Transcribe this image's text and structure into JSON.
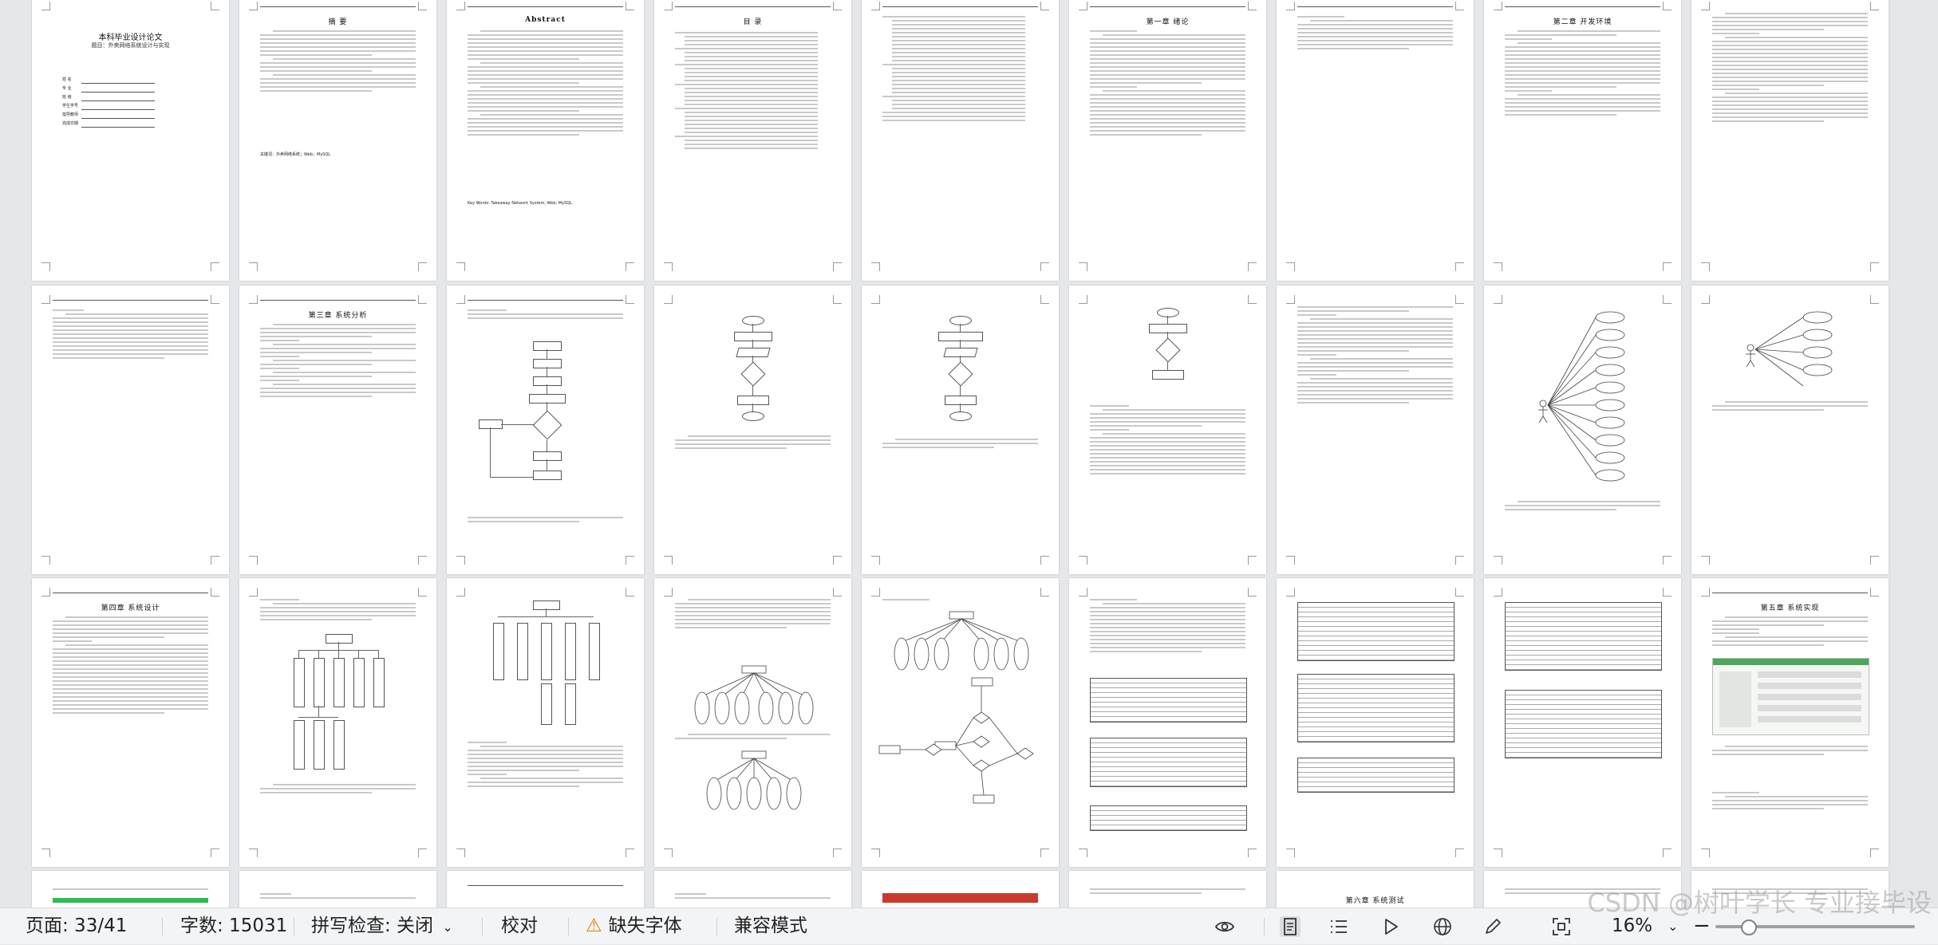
{
  "document": {
    "cover": {
      "title": "本科毕业设计论文",
      "subtitle": "题目：外卖网络系统设计与实现",
      "fields": [
        "姓  名",
        "专  业",
        "班  级",
        "学生学号",
        "指导教师",
        "完成日期"
      ]
    },
    "pages": {
      "abstract_cn": "摘  要",
      "abstract_cn_keywords": "关键词：外卖网络系统；Web；MySQL",
      "abstract_en": "Abstract",
      "abstract_en_keywords": "Key Words: Takeaway Network System; Web; MySQL",
      "toc": "目  录",
      "ch1": "第一章  绪论",
      "ch2": "第二章  开发环境",
      "ch3": "第三章  系统分析",
      "ch4": "第四章  系统设计",
      "ch5": "第五章  系统实现",
      "ch6": "第六章  系统测试"
    }
  },
  "statusbar": {
    "page_info": "页面: 33/41",
    "word_count": "字数: 15031",
    "spellcheck": "拼写检查: 关闭",
    "proofread": "校对",
    "missing_font": "缺失字体",
    "compat_mode": "兼容模式",
    "zoom": "16%",
    "zoom_fraction": 0.16,
    "icons": [
      "eye-icon",
      "page-view-icon",
      "outline-icon",
      "play-icon",
      "globe-icon",
      "pen-icon",
      "fit-screen-icon"
    ],
    "warning_color": "#d98200"
  },
  "watermark": "CSDN @树叶学长 专业接毕设"
}
